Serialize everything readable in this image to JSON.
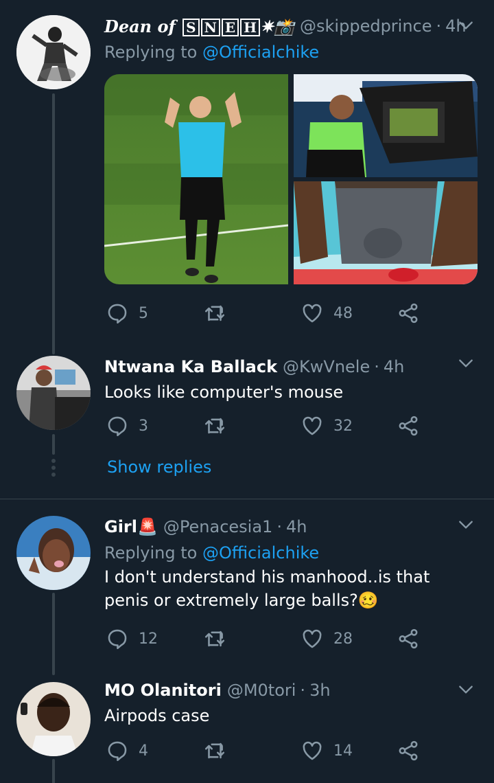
{
  "tweets": [
    {
      "name_prefix": "Dean of",
      "name_boxed": [
        "S",
        "N",
        "E",
        "H"
      ],
      "name_suffix": "✷📸",
      "handle": "@skippedprince",
      "time": "4h",
      "replying_to_label": "Replying to",
      "replying_to": "@Officialchike",
      "text": "",
      "replies": "5",
      "retweets": "",
      "likes": "48"
    },
    {
      "name": "Ntwana Ka Ballack",
      "handle": "@KwVnele",
      "time": "4h",
      "text": "Looks like computer's mouse",
      "replies": "3",
      "retweets": "",
      "likes": "32"
    },
    {
      "name": "Girl",
      "name_emoji": "🚨",
      "handle": "@Penacesia1",
      "time": "4h",
      "replying_to_label": "Replying to",
      "replying_to": "@Officialchike",
      "text": "I don't understand his manhood..is that penis or extremely large balls?🥴",
      "replies": "12",
      "retweets": "",
      "likes": "28"
    },
    {
      "name": "MO Olanitori",
      "handle": "@M0tori",
      "time": "3h",
      "text": "Airpods case",
      "replies": "4",
      "retweets": "",
      "likes": "14"
    }
  ],
  "show_replies_label": "Show replies",
  "colors": {
    "background": "#15202b",
    "muted": "#8899a6",
    "accent": "#1da1f2",
    "border": "#38444d"
  },
  "icons": [
    "reply-icon",
    "retweet-icon",
    "like-icon",
    "share-icon",
    "chevron-down-icon"
  ]
}
